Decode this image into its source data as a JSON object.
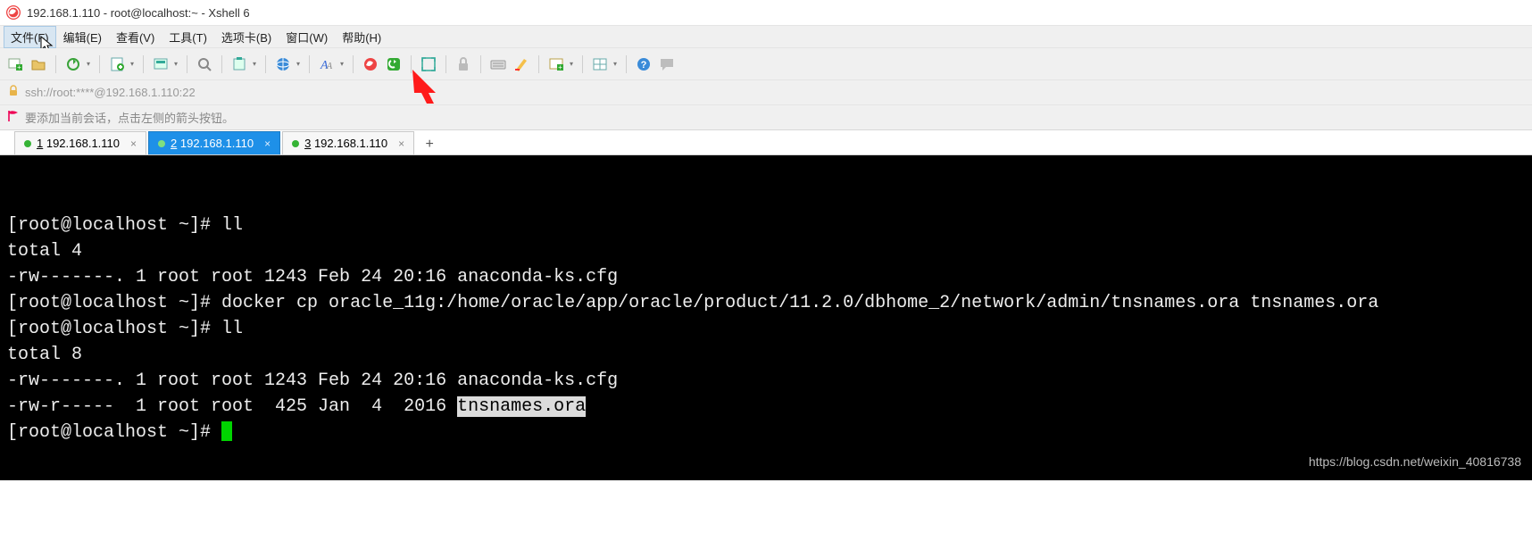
{
  "title": "192.168.1.110 - root@localhost:~ - Xshell 6",
  "menu": {
    "file": "文件(F)",
    "edit": "编辑(E)",
    "view": "查看(V)",
    "tools": "工具(T)",
    "tabs": "选项卡(B)",
    "window": "窗口(W)",
    "help": "帮助(H)"
  },
  "toolbar_icons": [
    "new-session-icon",
    "open-icon",
    "sep",
    "reconnect-icon",
    "dd",
    "sep",
    "properties-icon",
    "dd",
    "sep",
    "copy-icon",
    "dd",
    "sep",
    "find-icon",
    "sep",
    "paste-icon",
    "dd",
    "sep",
    "globe-icon",
    "dd",
    "sep",
    "font-icon",
    "dd",
    "sep",
    "xshell-icon",
    "xagent-icon",
    "sep",
    "fullscreen-icon",
    "sep",
    "lock-icon",
    "sep",
    "keyboard-icon",
    "highlight-icon",
    "sep",
    "add-tab-icon",
    "dd",
    "sep",
    "layout-icon",
    "dd",
    "sep",
    "help-icon",
    "chat-icon"
  ],
  "address": {
    "text": "ssh://root:****@192.168.1.110:22"
  },
  "hint": {
    "text": "要添加当前会话，点击左侧的箭头按钮。"
  },
  "tabs": [
    {
      "num": "1",
      "label": "192.168.1.110",
      "active": false
    },
    {
      "num": "2",
      "label": "192.168.1.110",
      "active": true
    },
    {
      "num": "3",
      "label": "192.168.1.110",
      "active": false
    }
  ],
  "terminal": {
    "lines": [
      "[root@localhost ~]# ll",
      "total 4",
      "-rw-------. 1 root root 1243 Feb 24 20:16 anaconda-ks.cfg",
      "[root@localhost ~]# docker cp oracle_11g:/home/oracle/app/oracle/product/11.2.0/dbhome_2/network/admin/tnsnames.ora tnsnames.ora",
      "[root@localhost ~]# ll",
      "total 8",
      "-rw-------. 1 root root 1243 Feb 24 20:16 anaconda-ks.cfg"
    ],
    "line_hl_prefix": "-rw-r-----  1 root root  425 Jan  4  2016 ",
    "line_hl_text": "tnsnames.ora",
    "prompt": "[root@localhost ~]# "
  },
  "watermark": "https://blog.csdn.net/weixin_40816738"
}
